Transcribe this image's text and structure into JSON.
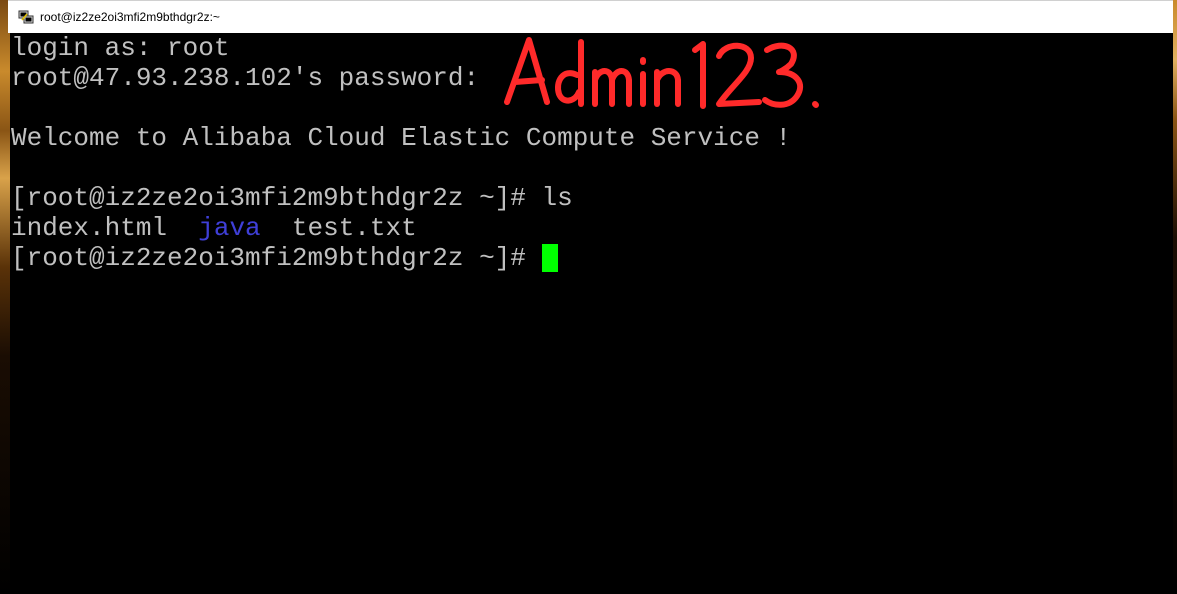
{
  "window": {
    "title": "root@iz2ze2oi3mfi2m9bthdgr2z:~",
    "app_icon": "putty-terminal-icon"
  },
  "terminal": {
    "login_prompt": "login as: ",
    "login_user": "root",
    "password_prompt": "root@47.93.238.102's password: ",
    "welcome": "Welcome to Alibaba Cloud Elastic Compute Service !",
    "prompt": "[root@iz2ze2oi3mfi2m9bthdgr2z ~]# ",
    "command": "ls",
    "ls_output": {
      "file1": "index.html",
      "dir1": "java",
      "file2": "test.txt"
    },
    "cursor_color": "#00ff00",
    "text_color": "#c0c0c0",
    "dir_color": "#3f3fd8"
  },
  "annotation": {
    "handwritten_text": "Admin123.",
    "color": "#ff2a2a"
  }
}
